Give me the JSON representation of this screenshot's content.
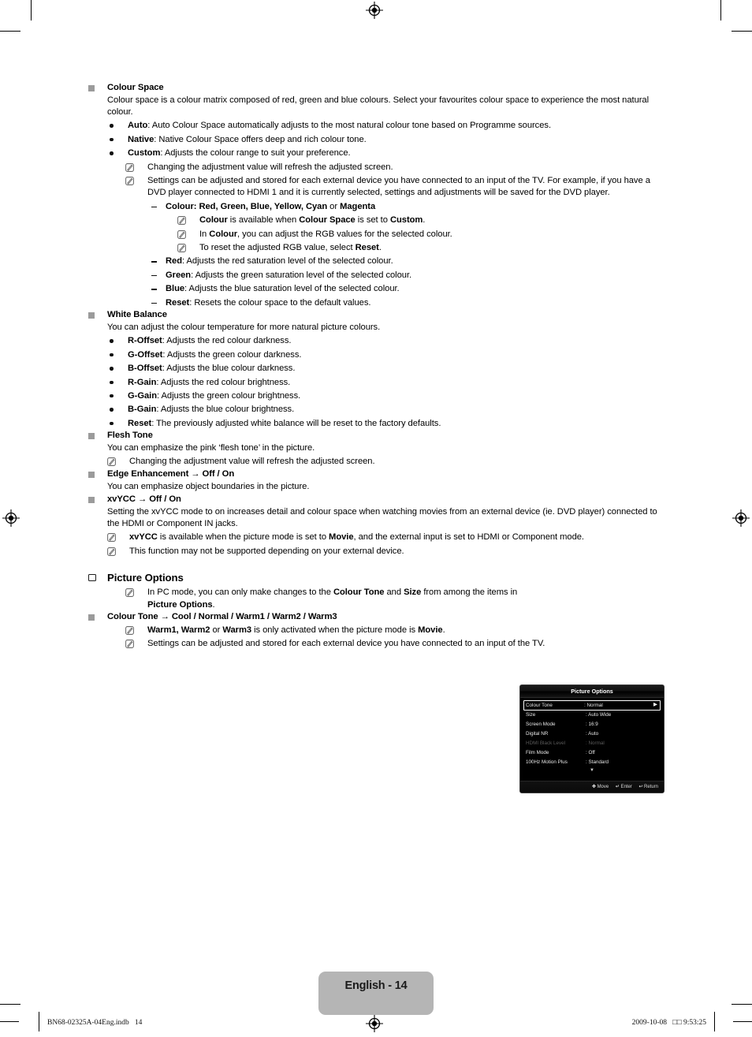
{
  "page": {
    "number_label": "English - 14",
    "footer_left": "BN68-02325A-04Eng.indb   14",
    "footer_right": "2009-10-08   □□ 9:53:25"
  },
  "sections": {
    "colour_space": {
      "heading": "Colour Space",
      "intro": "Colour space is a colour matrix composed of red, green and blue colours. Select your favourites colour space to experience the most natural colour.",
      "bullets": [
        {
          "term": "Auto",
          "rest": ": Auto Colour Space automatically adjusts to the most natural colour tone based on Programme sources."
        },
        {
          "term": "Native",
          "rest": ": Native Colour Space offers deep and rich colour tone."
        },
        {
          "term": "Custom",
          "rest": ": Adjusts the colour range to suit your preference."
        }
      ],
      "note1": "Changing the adjustment value will refresh the adjusted screen.",
      "note2": "Settings can be adjusted and stored for each external device you have connected to an input of the TV. For example, if you have a DVD player connected to HDMI 1 and it is currently selected, settings and adjustments will be saved for the DVD player.",
      "colour_dash": {
        "bold_a": "Colour: Red, Green, Blue, Yellow, Cyan",
        "mid": " or ",
        "bold_b": "Magenta"
      },
      "colour_notes": [
        {
          "b1": "Colour",
          "t1": " is available when ",
          "b2": "Colour Space",
          "t2": " is set to ",
          "b3": "Custom",
          "t3": "."
        },
        {
          "b1": "In ",
          "t1": "",
          "b2": "Colour",
          "t2": ", you can adjust the RGB values for the selected colour.",
          "b3": "",
          "t3": ""
        },
        {
          "b1": "To reset the adjusted RGB value, select ",
          "t1": "",
          "b2": "Reset",
          "t2": ".",
          "b3": "",
          "t3": ""
        }
      ],
      "note_red": "Colour is available when Colour Space is set to Custom.",
      "note_in_colour": "In Colour, you can adjust the RGB values for the selected colour.",
      "note_reset_rgb": "To reset the adjusted RGB value, select Reset.",
      "dashes": [
        {
          "term": "Red",
          "rest": ": Adjusts the red saturation level of the selected colour."
        },
        {
          "term": "Green",
          "rest": ": Adjusts the green saturation level of the selected colour."
        },
        {
          "term": "Blue",
          "rest": ": Adjusts the blue saturation level of the selected colour."
        },
        {
          "term": "Reset",
          "rest": ": Resets the colour space to the default values."
        }
      ]
    },
    "white_balance": {
      "heading": "White Balance",
      "intro": "You can adjust the colour temperature for more natural picture colours.",
      "bullets": [
        {
          "term": "R-Offset",
          "rest": ": Adjusts the red colour darkness."
        },
        {
          "term": "G-Offset",
          "rest": ": Adjusts the green colour darkness."
        },
        {
          "term": "B-Offset",
          "rest": ": Adjusts the blue colour darkness."
        },
        {
          "term": "R-Gain",
          "rest": ": Adjusts the red colour brightness."
        },
        {
          "term": "G-Gain",
          "rest": ": Adjusts the green colour brightness."
        },
        {
          "term": "B-Gain",
          "rest": ": Adjusts the blue colour brightness."
        },
        {
          "term": "Reset",
          "rest": ": The previously adjusted white balance will be reset to the factory defaults."
        }
      ]
    },
    "flesh_tone": {
      "heading": "Flesh Tone",
      "intro": "You can emphasize the pink ‘flesh tone’ in the picture.",
      "note": "Changing the adjustment value will refresh the adjusted screen."
    },
    "edge_enhancement": {
      "heading": "Edge Enhancement → Off / On",
      "intro": "You can emphasize object boundaries in the picture."
    },
    "xvycc": {
      "heading": "xvYCC → Off / On",
      "intro": "Setting the xvYCC mode to on increases detail and colour space when watching movies from an external device (ie. DVD player) connected to the HDMI or Component IN jacks.",
      "note1_b1": "xvYCC",
      "note1_t1": " is available when the picture mode is set to ",
      "note1_b2": "Movie",
      "note1_t2": ", and the external input is set to HDMI or Component mode.",
      "note2": "This function may not be supported depending on your external device."
    },
    "picture_options": {
      "heading": "Picture Options",
      "note_b0": "In PC mode, you can only make changes to the ",
      "note_b1": "Colour Tone",
      "note_t1": " and ",
      "note_b2": "Size",
      "note_t2": " from among the items in ",
      "note_b3": "Picture Options",
      "note_t3": "."
    },
    "colour_tone": {
      "heading": "Colour Tone → Cool / Normal / Warm1 / Warm2 / Warm3",
      "note1_b1": "Warm1, Warm2",
      "note1_t1": " or ",
      "note1_b2": "Warm3",
      "note1_t2": " is only activated when the picture mode is ",
      "note1_b3": "Movie",
      "note1_t3": ".",
      "note2": "Settings can be adjusted and stored for each external device you have connected to an input of the TV."
    }
  },
  "osd": {
    "title": "Picture Options",
    "rows": [
      {
        "label": "Colour Tone",
        "value": ": Normal",
        "selected": true,
        "dimmed": false,
        "arrow": "▶"
      },
      {
        "label": "Size",
        "value": ": Auto Wide",
        "selected": false,
        "dimmed": false,
        "arrow": ""
      },
      {
        "label": "Screen Mode",
        "value": ": 16:9",
        "selected": false,
        "dimmed": false,
        "arrow": ""
      },
      {
        "label": "Digital NR",
        "value": ": Auto",
        "selected": false,
        "dimmed": false,
        "arrow": ""
      },
      {
        "label": "HDMI Black Level",
        "value": ": Normal",
        "selected": false,
        "dimmed": true,
        "arrow": ""
      },
      {
        "label": "Film Mode",
        "value": ": Off",
        "selected": false,
        "dimmed": false,
        "arrow": ""
      },
      {
        "label": "100Hz Motion Plus",
        "value": ": Standard",
        "selected": false,
        "dimmed": false,
        "arrow": ""
      }
    ],
    "scroll_down_glyph": "▼",
    "footer": [
      {
        "glyph": "✥",
        "label": "Move"
      },
      {
        "glyph": "↵",
        "label": "Enter"
      },
      {
        "glyph": "↩",
        "label": "Return"
      }
    ]
  },
  "colors": {
    "page_tag_bg": "#b5b5b5",
    "square_marker": "#9b9b9b",
    "osd_bg": "#000000",
    "osd_text": "#e8e8e8",
    "osd_dim_text": "#5c5c5c"
  }
}
